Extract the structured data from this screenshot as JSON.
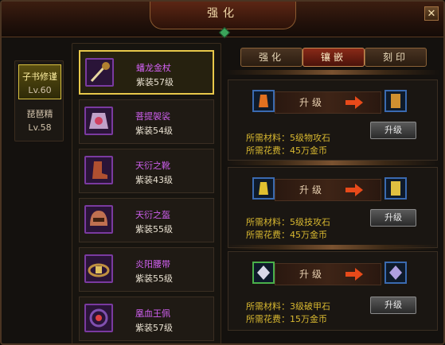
{
  "window": {
    "title": "强化",
    "close_label": "✕"
  },
  "characters": [
    {
      "name": "子书修谨",
      "level": "Lv.60",
      "selected": true
    },
    {
      "name": "琵琶精",
      "level": "Lv.58",
      "selected": false
    }
  ],
  "items": [
    {
      "name": "蟠龙金杖",
      "grade": "紫装57级",
      "icon": "staff-icon",
      "selected": true
    },
    {
      "name": "菩提袈裟",
      "grade": "紫装54级",
      "icon": "robe-icon",
      "selected": false
    },
    {
      "name": "天衍之靴",
      "grade": "紫装43级",
      "icon": "boots-icon",
      "selected": false
    },
    {
      "name": "天衍之盔",
      "grade": "紫装55级",
      "icon": "helmet-icon",
      "selected": false
    },
    {
      "name": "炎阳腰带",
      "grade": "紫装55级",
      "icon": "belt-icon",
      "selected": false
    },
    {
      "name": "凰血王佩",
      "grade": "紫装57级",
      "icon": "pendant-icon",
      "selected": false
    }
  ],
  "tabs": [
    {
      "label": "强化",
      "active": false
    },
    {
      "label": "镶嵌",
      "active": true
    },
    {
      "label": "刻印",
      "active": false
    }
  ],
  "upgrades": [
    {
      "label": "升级",
      "material_text": "所需材料：5级物攻石",
      "cost_text": "所需花费：45万金币",
      "button": "升级",
      "gem": "orange-gem-icon"
    },
    {
      "label": "升级",
      "material_text": "所需材料：5级技攻石",
      "cost_text": "所需花费：45万金币",
      "button": "升级",
      "gem": "yellow-gem-icon"
    },
    {
      "label": "升级",
      "material_text": "所需材料：3级破甲石",
      "cost_text": "所需花费：15万金币",
      "button": "升级",
      "gem": "white-gem-icon"
    }
  ],
  "colors": {
    "item_name": "#d060f0",
    "cost_text": "#d8b830",
    "selected_border": "#e8c84a",
    "active_tab": "#8a2a18"
  }
}
